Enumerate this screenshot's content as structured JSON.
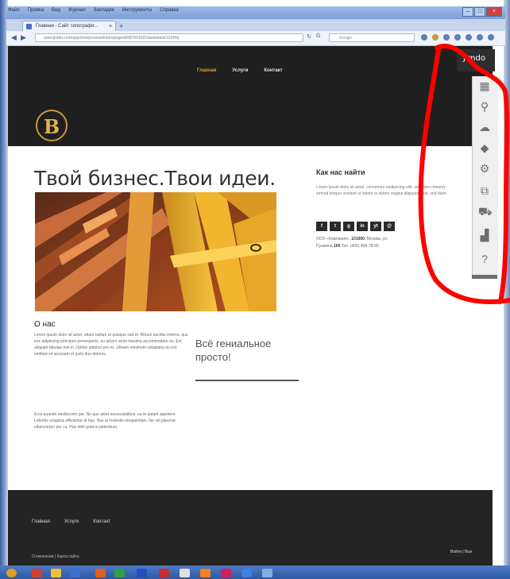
{
  "browser": {
    "menu": [
      "Файл",
      "Правка",
      "Вид",
      "Журнал",
      "Закладки",
      "Инструменты",
      "Справка"
    ],
    "tab_title": "Главная - Сайт типографи...",
    "tab_close": "×",
    "new_tab": "+",
    "url": "www.jimdo.com/app/cms/preview/index/pageId/987654321/websiteid/123456",
    "search_placeholder": "Google",
    "window_buttons": [
      "–",
      "□",
      "×"
    ]
  },
  "site": {
    "nav": [
      "Главная",
      "Услуги",
      "Контакт"
    ],
    "logo_letter": "B",
    "hero_title": "Твой бизнес.Твои идеи.",
    "about_title": "О нас",
    "about_p1": "Lorem ipsum dolor sit amet, etiam nullam et quisque sed et. Ritrum ascribe interno, quo eos adipiscing principes persequeris, eu ad pro anim maxima accommodare eu. Est aliquam fabulas mei in. Option adipisci pro ex. Utinam minimum voluptaria eu est omittam et accusam et justo duo dolores.",
    "about_p2": "Eros quando mediocrem per. Ne quo amet necessitatibus, ea te putant appetere. Lobortis voluptua efficiantur id has. Has at molestie eloquentiam. Ne vel placerat ullamcorper per cu. Has nibh graeco petentium.",
    "quote": "Всё гениальное просто!",
    "find_title": "Как нас найти",
    "find_text": "Lorem ipsum dolor sit amet, consetetur sadipscing elitr, sed diam nonumy eirmod tempor invidunt ut labore et dolore magna aliquyam erat, sed diam.",
    "social": [
      "f",
      "t",
      "g",
      "in",
      "yt",
      "@"
    ],
    "address_prefix": "ООО «Компания», ",
    "address_zip": "101000",
    "address_city": ", Москва, ул.",
    "address_street": "Пушкина ",
    "address_house": "100",
    "address_phone": " Тел. (495) 456-78-90",
    "footer_nav": [
      "Главная",
      "Услуги",
      "Контакт"
    ],
    "footer_copy": "О компании | Карта сайта",
    "footer_right": "Войти | Вых"
  },
  "extension": {
    "badge": "Jimdo",
    "icons": [
      "layout-icon",
      "tie-icon",
      "paint-icon",
      "box-icon",
      "gear-icon",
      "preview-icon",
      "cart-icon",
      "stats-icon",
      "help-icon"
    ]
  },
  "colors": {
    "header_bg": "#1f1f1f",
    "accent": "#d4a53a",
    "annotation": "#ff0000",
    "taskbar": "#2c58a4"
  }
}
